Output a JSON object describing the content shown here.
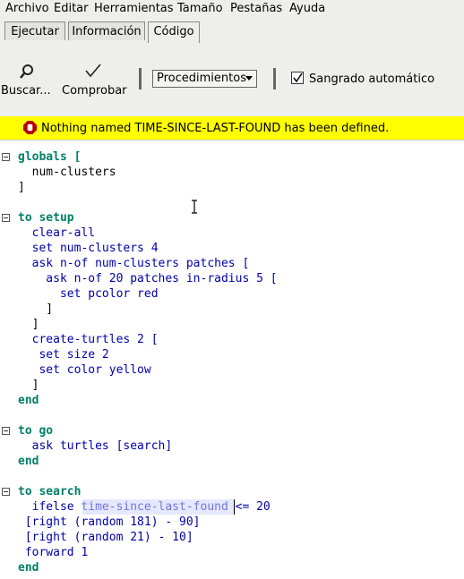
{
  "menubar": [
    "Archivo",
    "Editar",
    "Herramientas",
    "Tamaño",
    "Pestañas",
    "Ayuda"
  ],
  "tabs": [
    {
      "label": "Ejecutar",
      "active": false
    },
    {
      "label": "Información",
      "active": false
    },
    {
      "label": "Código",
      "active": true
    }
  ],
  "toolbar": {
    "find_label": "Buscar...",
    "check_label": "Comprobar",
    "procedures_label": "Procedimientos",
    "auto_indent_label": "Sangrado automático",
    "auto_indent_checked": true
  },
  "error": {
    "message": "Nothing named TIME-SINCE-LAST-FOUND has been defined.",
    "background": "#ffff00"
  },
  "code": {
    "lines": [
      "globals [",
      "  num-clusters",
      "]",
      "",
      "to setup",
      "  clear-all",
      "  set num-clusters 4",
      "  ask n-of num-clusters patches [",
      "    ask n-of 20 patches in-radius 5 [",
      "      set pcolor red",
      "    ]",
      "  ]",
      "  create-turtles 2 [",
      "   set size 2",
      "   set color yellow",
      "  ]",
      "end",
      "",
      "to go",
      "  ask turtles [search]",
      "end",
      "",
      "to search",
      "  ifelse time-since-last-found <= 20",
      " [right (random 181) - 90]",
      " [right (random 21) - 10]",
      " forward 1",
      "end"
    ],
    "selected_token": "time-since-last-found"
  },
  "colors": {
    "keyword": "#007f69",
    "command": "#0000aa",
    "reporter": "#660096",
    "number": "#963700",
    "selection": "#cfd6ff"
  }
}
